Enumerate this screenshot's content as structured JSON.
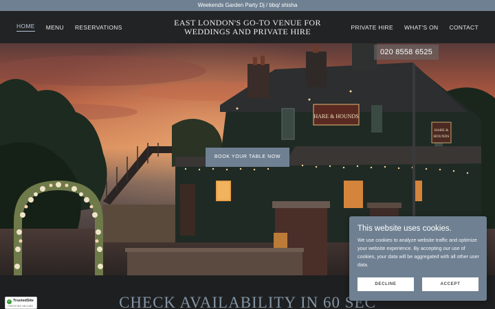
{
  "announcement": {
    "text": "Weekends Garden Party Dj / bbq/ shisha"
  },
  "header": {
    "nav_left": [
      {
        "label": "HOME",
        "active": true
      },
      {
        "label": "MENU",
        "active": false
      },
      {
        "label": "RESERVATIONS",
        "active": false
      }
    ],
    "title_line1": "EAST LONDON'S GO-TO VENUE FOR",
    "title_line2": "WEDDINGS AND PRIVATE HIRE",
    "nav_right": [
      {
        "label": "PRIVATE HIRE"
      },
      {
        "label": "WHAT'S ON"
      },
      {
        "label": "CONTACT"
      }
    ]
  },
  "hero": {
    "phone": "020 8558 6525",
    "cta_label": "BOOK YOUR TABLE NOW",
    "pub_sign": "HARE & HOUNDS",
    "side_sign_line1": "HARE &",
    "side_sign_line2": "HOUNDS"
  },
  "section": {
    "heading": "CHECK AVAILABILITY IN 60 SEC"
  },
  "badge": {
    "title": "TrustedSite",
    "subtitle": "CERTIFIED SECURE"
  },
  "cookie_banner": {
    "title": "This website uses cookies.",
    "body": "We use cookies to analyze website traffic and optimize your website experience. By accepting our use of cookies, your data will be aggregated with all other user data.",
    "decline_label": "DECLINE",
    "accept_label": "ACCEPT"
  },
  "colors": {
    "accent": "#6f8092",
    "header_bg": "#222324",
    "page_bg": "#1e1f20"
  }
}
